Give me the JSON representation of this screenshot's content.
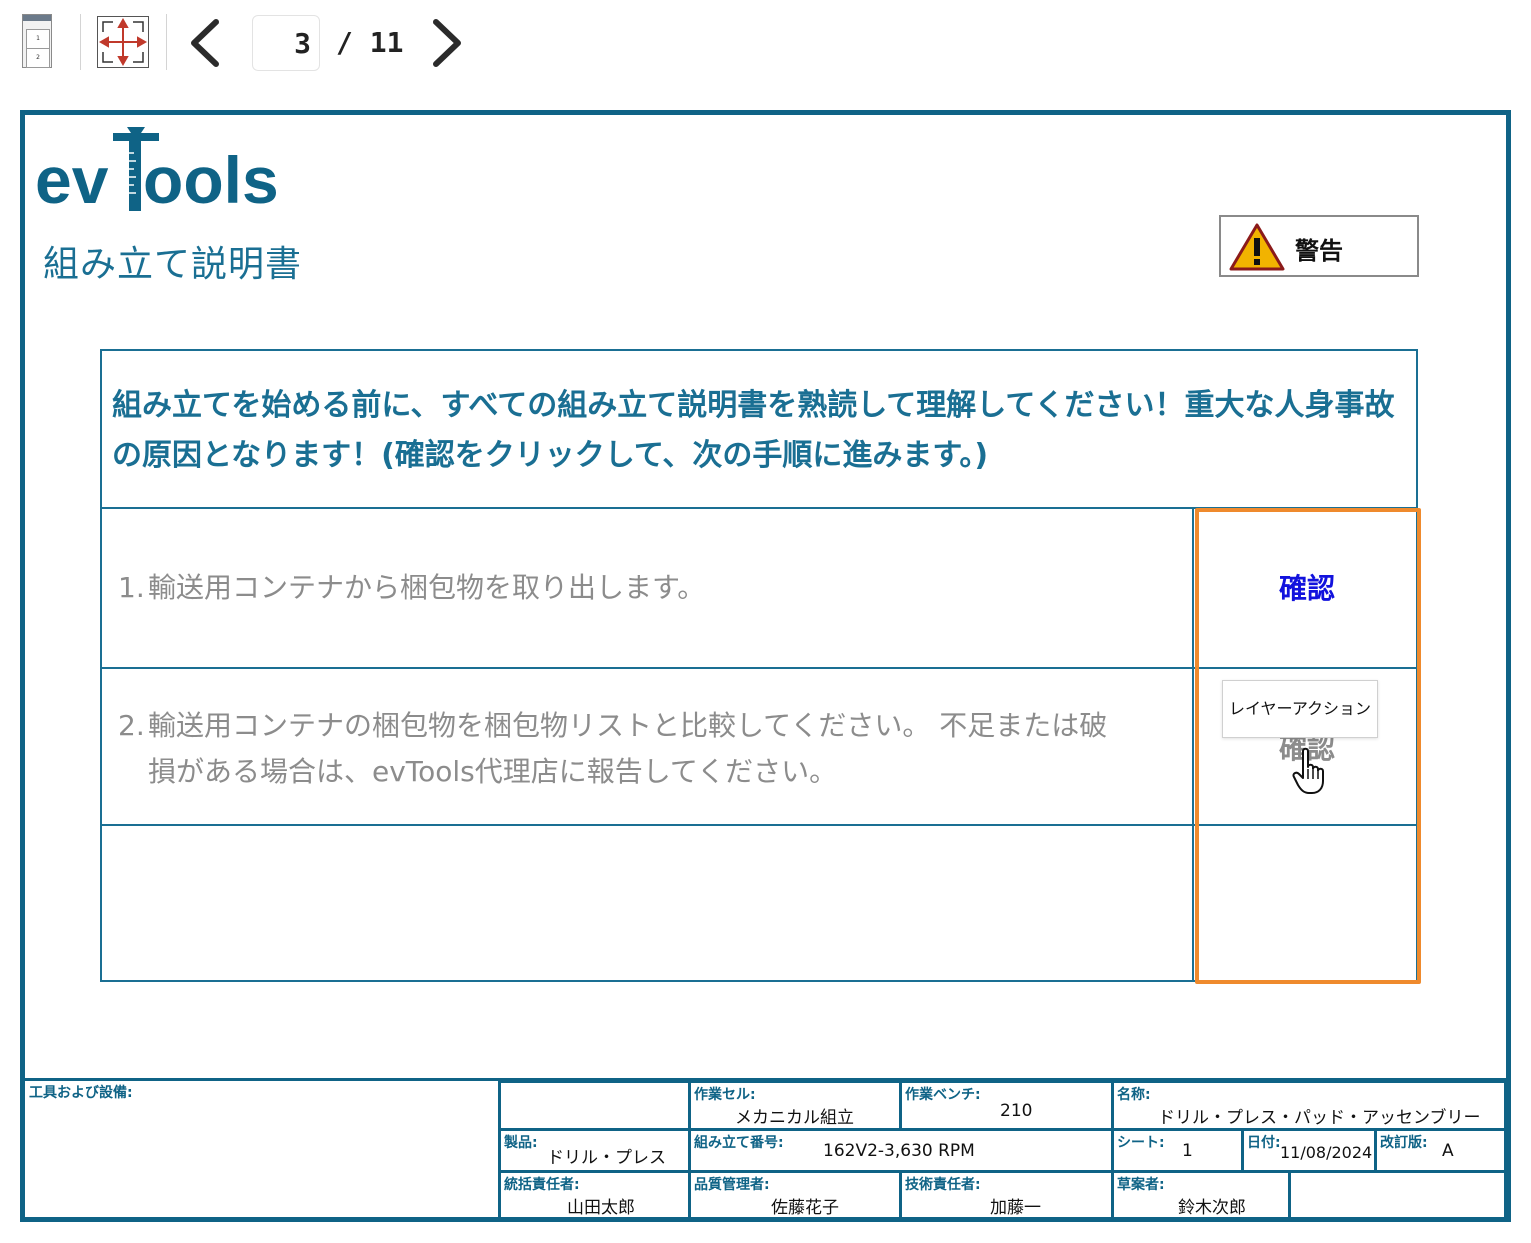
{
  "toolbar": {
    "page_current": "3",
    "page_total": "/ 11",
    "thumb_page_1": "1",
    "thumb_page_2": "2"
  },
  "document": {
    "logo_text": "evTools",
    "title": "組み立て説明書",
    "warning_label": "警告",
    "instruction_header": "組み立てを始める前に、すべての組み立て説明書を熟読して理解してください！重大な人身事故の原因となります！(確認をクリックして、次の手順に進みます。)",
    "steps": [
      {
        "number": "1.",
        "text": "輸送用コンテナから梱包物を取り出します。",
        "action": "確認",
        "state": "active"
      },
      {
        "number": "2.",
        "text_line1": "輸送用コンテナの梱包物を梱包物リストと比較してください。 不足または破",
        "text_line2": "損がある場合は、evTools代理店に報告してください。",
        "action": "確認",
        "state": "disabled"
      }
    ],
    "tooltip": "レイヤーアクション"
  },
  "title_block": {
    "tools_label": "工具および設備:",
    "work_cell_label": "作業セル:",
    "work_cell_value": "メカニカル組立",
    "work_bench_label": "作業ベンチ:",
    "work_bench_value": "210",
    "name_label": "名称:",
    "name_value": "ドリル・プレス・パッド・アッセンブリー",
    "product_label": "製品:",
    "product_value": "ドリル・プレス",
    "assembly_no_label": "組み立て番号:",
    "assembly_no_value": "162V2-3,630 RPM",
    "sheet_label": "シート:",
    "sheet_value": "1",
    "date_label": "日付:",
    "date_value": "11/08/2024",
    "revision_label": "改訂版:",
    "revision_value": "A",
    "supervisor_label": "統括責任者:",
    "supervisor_value": "山田太郎",
    "qa_label": "品質管理者:",
    "qa_value": "佐藤花子",
    "tech_label": "技術責任者:",
    "tech_value": "加藤一",
    "drafter_label": "草案者:",
    "drafter_value": "鈴木次郎"
  },
  "colors": {
    "brand_blue": "#0f6386",
    "link_blue": "#1212dd",
    "highlight_orange": "#ef8a2d",
    "muted_gray": "#8c8c8c"
  },
  "icons": {
    "pages": "page-thumbnails-icon",
    "fit": "fit-to-page-icon",
    "prev": "chevron-left-icon",
    "next": "chevron-right-icon",
    "warning": "warning-triangle-icon",
    "cursor": "hand-pointer-icon"
  }
}
